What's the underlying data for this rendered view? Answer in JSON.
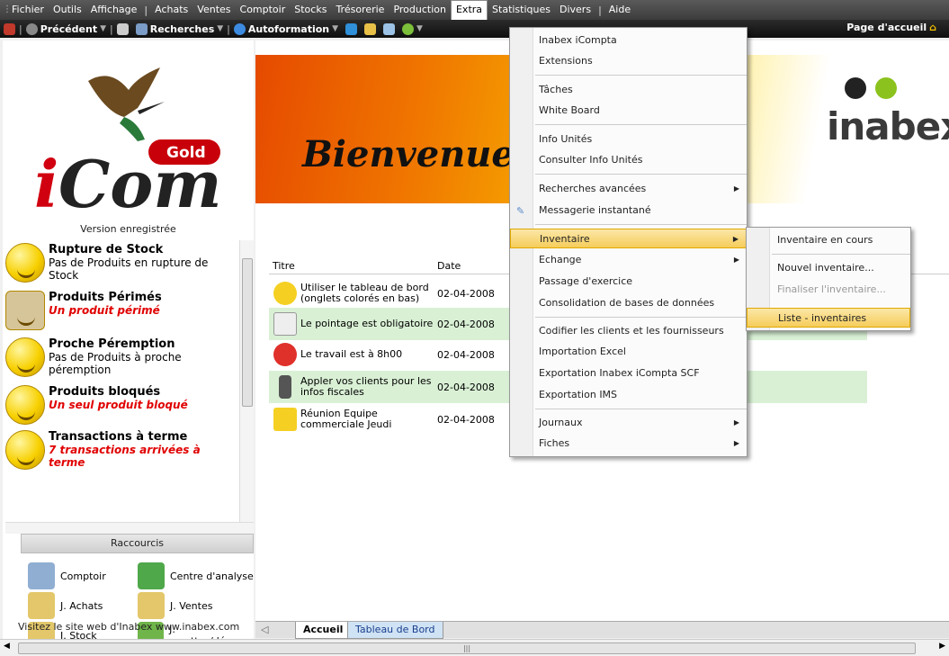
{
  "menubar": [
    "Fichier",
    "Outils",
    "Affichage",
    "|",
    "Achats",
    "Ventes",
    "Comptoir",
    "Stocks",
    "Trésorerie",
    "Production",
    "Extra",
    "Statistiques",
    "Divers",
    "|",
    "Aide"
  ],
  "toolbar": {
    "back": "Précédent",
    "search": "Recherches",
    "training": "Autoformation",
    "home": "Page d'accueil"
  },
  "left": {
    "version": "Version enregistrée",
    "alerts": [
      {
        "title": "Rupture de Stock",
        "desc": "Pas de Produits en rupture de Stock",
        "red": false
      },
      {
        "title": "Produits Périmés",
        "desc": "Un produit périmé",
        "red": true
      },
      {
        "title": "Proche Péremption",
        "desc": "Pas de Produits à proche péremption",
        "red": false
      },
      {
        "title": "Produits bloqués",
        "desc": "Un seul produit bloqué",
        "red": true
      },
      {
        "title": "Transactions à terme",
        "desc": "7 transactions arrivées à terme",
        "red": true
      }
    ],
    "shortcuts_title": "Raccourcis",
    "shortcuts": [
      "Comptoir",
      "Centre d'analyse",
      "J. Achats",
      "J. Ventes",
      "J. Stock",
      "J. recettes/dépe..."
    ],
    "visit": "Visitez le site web d'Inabex  www.inabex.com",
    "logo_text": "iCom",
    "logo_badge": "Gold"
  },
  "main": {
    "welcome": "Bienvenue",
    "brand": "inabex",
    "columns": {
      "title": "Titre",
      "date": "Date"
    },
    "rows": [
      {
        "title": "Utiliser le tableau de bord (onglets colorés en bas)",
        "date": "02-04-2008",
        "icon": "lightbulb-icon"
      },
      {
        "title": "Le pointage est obligatoire",
        "date": "02-04-2008",
        "icon": "checklist-icon"
      },
      {
        "title": "Le travail est à 8h00",
        "date": "02-04-2008",
        "icon": "alarm-clock-icon"
      },
      {
        "title": "Appler vos clients pour les infos fiscales",
        "date": "02-04-2008",
        "icon": "phone-icon"
      },
      {
        "title": "Réunion Equipe commerciale Jeudi",
        "date": "02-04-2008",
        "icon": "warning-icon"
      }
    ],
    "tabs": [
      "Accueil",
      "Tableau de Bord"
    ]
  },
  "extra_menu": [
    "Inabex iCompta",
    "Extensions",
    "Tâches",
    "White Board",
    "Info Unités",
    "Consulter Info Unités",
    "Recherches avancées",
    "Messagerie instantané",
    "Inventaire",
    "Echange",
    "Passage d'exercice",
    "Consolidation de bases de données",
    "Codifier les clients et les fournisseurs",
    "Importation Excel",
    "Exportation Inabex iCompta SCF",
    "Exportation IMS",
    "Journaux",
    "Fiches"
  ],
  "inventaire_submenu": [
    "Inventaire en cours",
    "Nouvel inventaire...",
    "Finaliser l'inventaire...",
    "Liste - inventaires"
  ],
  "colors": {
    "highlight": "#f6cd5b",
    "menubar": "#4a4a4a",
    "red_text": "#e00000",
    "row_green": "#d9f0d5"
  }
}
